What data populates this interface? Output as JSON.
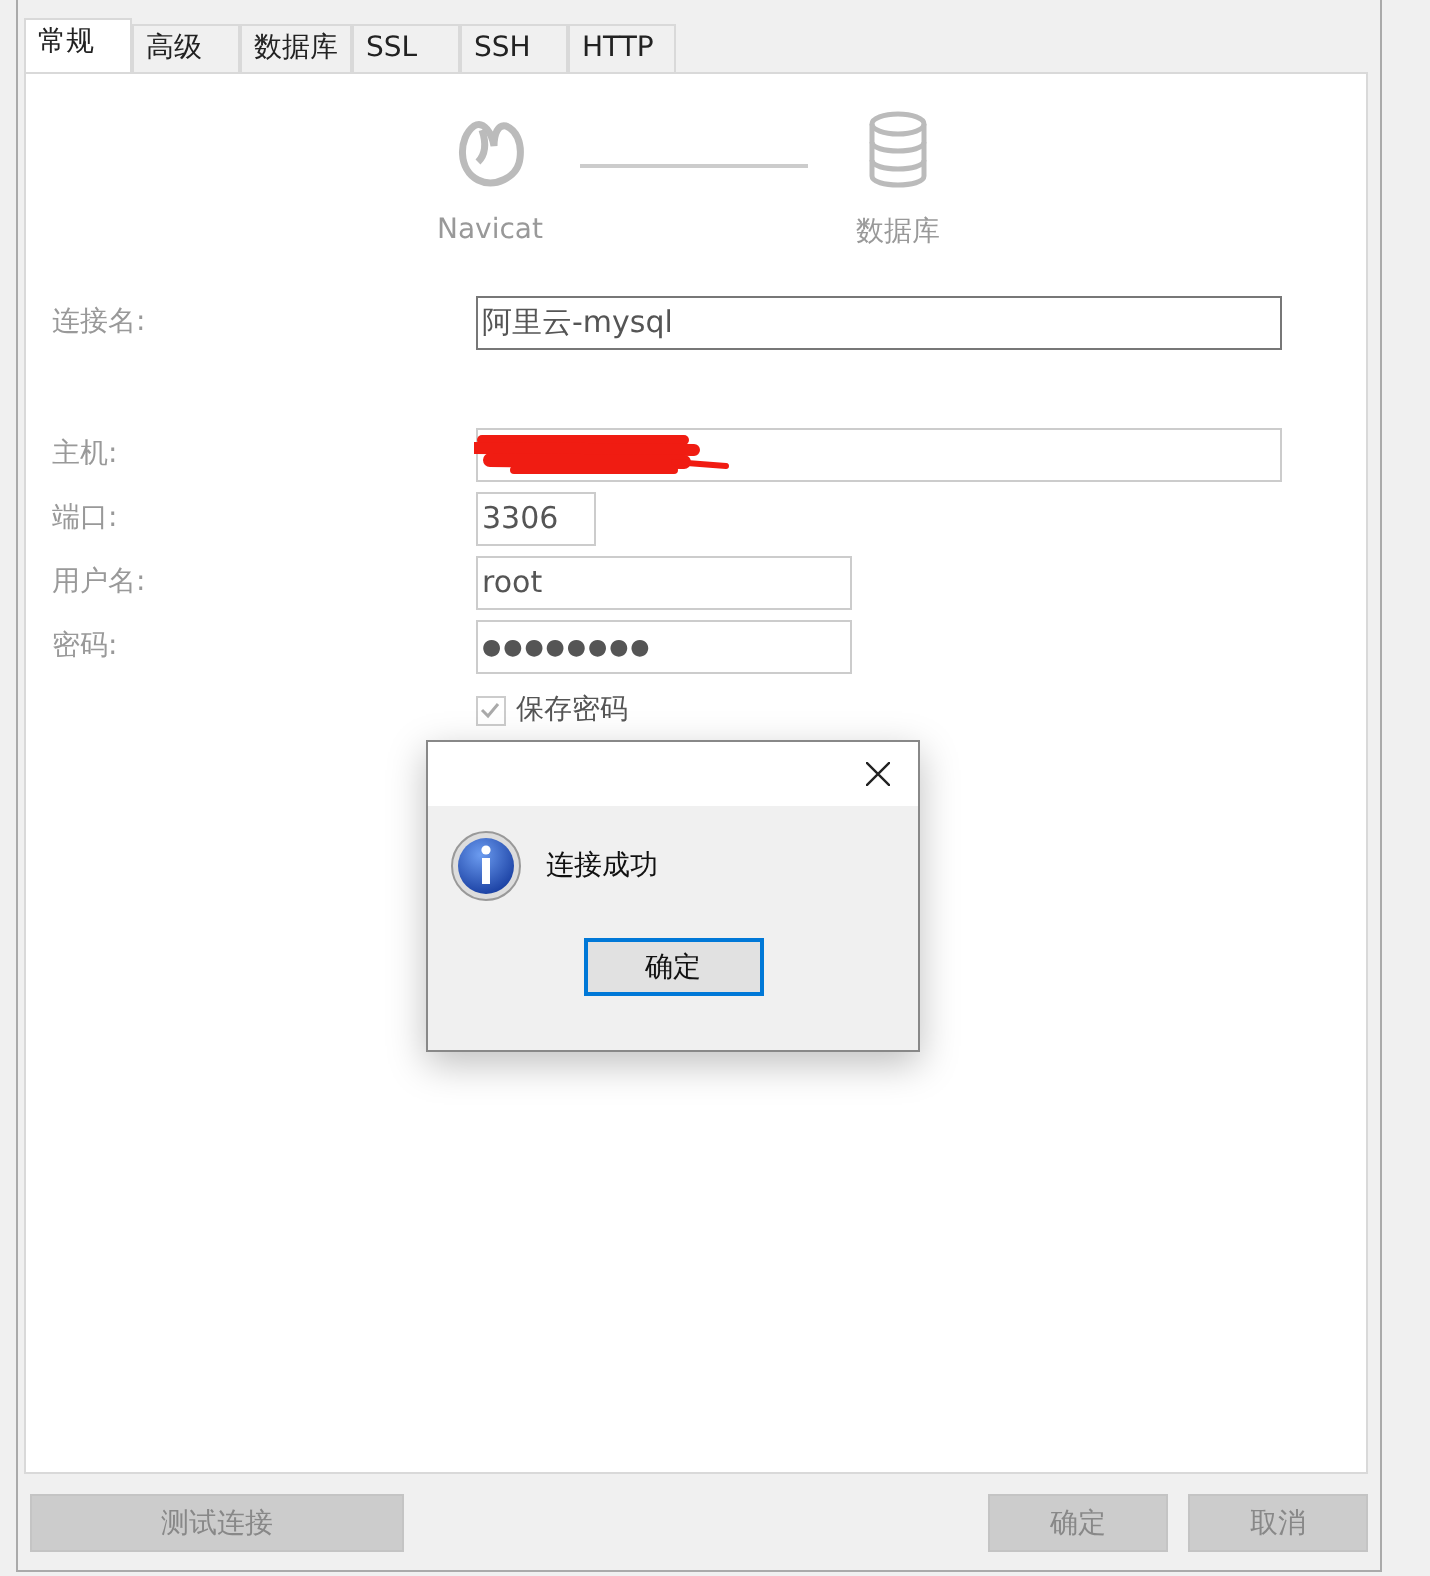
{
  "tabs": [
    {
      "label": "常规",
      "selected": true
    },
    {
      "label": "高级",
      "selected": false
    },
    {
      "label": "数据库",
      "selected": false
    },
    {
      "label": "SSL",
      "selected": false
    },
    {
      "label": "SSH",
      "selected": false
    },
    {
      "label": "HTTP",
      "selected": false
    }
  ],
  "connection": {
    "source": "Navicat",
    "target": "数据库"
  },
  "fields": [
    {
      "label": "连接名:",
      "value": "阿里云-mysql",
      "kind": "wide",
      "focused": true
    },
    {
      "label": "主机:",
      "kind": "redacted",
      "focused": false
    },
    {
      "label": "端口:",
      "value": "3306",
      "kind": "short",
      "focused": false
    },
    {
      "label": "用户名:",
      "value": "root",
      "kind": "medium",
      "focused": false
    },
    {
      "label": "密码:",
      "value": "●●●●●●●●",
      "kind": "medium",
      "focused": false
    }
  ],
  "save_password": {
    "label": "保存密码",
    "checked": true
  },
  "dialog": {
    "message": "连接成功",
    "button": "确定"
  },
  "buttons": {
    "test": "测试连接",
    "ok": "确定",
    "cancel": "取消"
  }
}
